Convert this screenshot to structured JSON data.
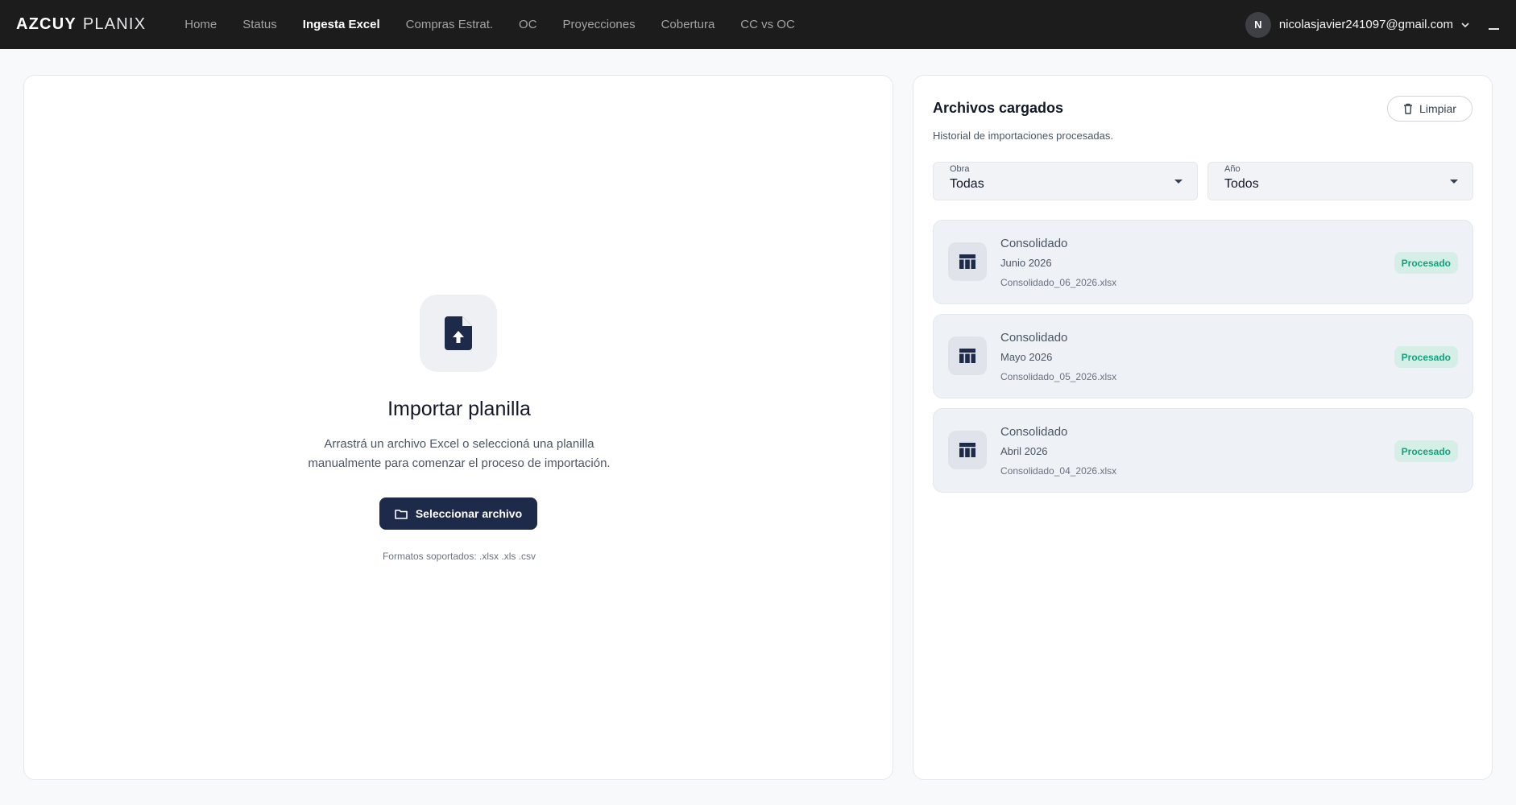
{
  "brand": {
    "part1": "AZCUY",
    "part2": "PLANIX"
  },
  "nav": [
    {
      "label": "Home",
      "active": false
    },
    {
      "label": "Status",
      "active": false
    },
    {
      "label": "Ingesta Excel",
      "active": true
    },
    {
      "label": "Compras Estrat.",
      "active": false
    },
    {
      "label": "OC",
      "active": false
    },
    {
      "label": "Proyecciones",
      "active": false
    },
    {
      "label": "Cobertura",
      "active": false
    },
    {
      "label": "CC vs OC",
      "active": false
    }
  ],
  "user": {
    "initial": "N",
    "email": "nicolasjavier241097@gmail.com",
    "menu_icon": "chevron-down-icon"
  },
  "import": {
    "icon": "file-upload-icon",
    "title": "Importar planilla",
    "description": "Arrastrá un archivo Excel o seleccioná una planilla manualmente para comenzar el proceso de importación.",
    "button_label": "Seleccionar archivo",
    "button_icon": "folder-icon",
    "formats": "Formatos soportados: .xlsx .xls .csv"
  },
  "history": {
    "title": "Archivos cargados",
    "subtitle": "Historial de importaciones procesadas.",
    "clear_label": "Limpiar",
    "clear_icon": "trash-icon",
    "filters": {
      "obra": {
        "label": "Obra",
        "value": "Todas"
      },
      "anio": {
        "label": "Año",
        "value": "Todos"
      }
    },
    "items": [
      {
        "title": "Consolidado",
        "period": "Junio 2026",
        "file": "Consolidado_06_2026.xlsx",
        "status": "Procesado"
      },
      {
        "title": "Consolidado",
        "period": "Mayo 2026",
        "file": "Consolidado_05_2026.xlsx",
        "status": "Procesado"
      },
      {
        "title": "Consolidado",
        "period": "Abril 2026",
        "file": "Consolidado_04_2026.xlsx",
        "status": "Procesado"
      }
    ]
  },
  "colors": {
    "topbar": "#1c1c1c",
    "primary_button": "#1e2a4a",
    "success_text": "#10a37f",
    "success_bg": "#d5efe6"
  }
}
